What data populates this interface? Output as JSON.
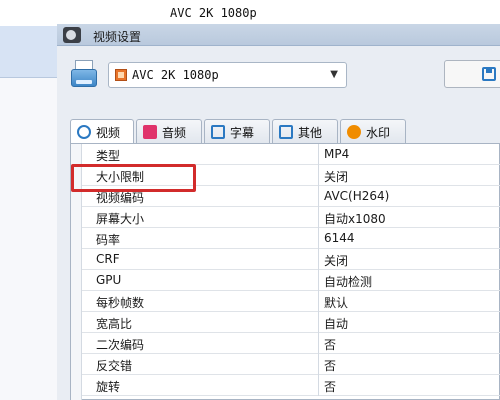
{
  "background": {
    "title": "AVC 2K 1080p"
  },
  "dialog": {
    "title": "视频设置"
  },
  "preset": {
    "selected": "AVC 2K 1080p"
  },
  "tabs": [
    {
      "label": "视频",
      "icon": "video-icon",
      "color": "#2b79c2"
    },
    {
      "label": "音频",
      "icon": "music-icon",
      "color": "#e0336b"
    },
    {
      "label": "字幕",
      "icon": "subtitle-icon",
      "color": "#2b79c2"
    },
    {
      "label": "其他",
      "icon": "settings-icon",
      "color": "#2b79c2"
    },
    {
      "label": "水印",
      "icon": "new-badge-icon",
      "color": "#f08c00"
    }
  ],
  "properties": [
    {
      "key": "类型",
      "value": "MP4"
    },
    {
      "key": "大小限制",
      "value": "关闭"
    },
    {
      "key": "视频编码",
      "value": "AVC(H264)"
    },
    {
      "key": "屏幕大小",
      "value": "自动x1080"
    },
    {
      "key": "码率",
      "value": "6144"
    },
    {
      "key": "CRF",
      "value": "关闭"
    },
    {
      "key": "GPU",
      "value": "自动检测"
    },
    {
      "key": "每秒帧数",
      "value": "默认"
    },
    {
      "key": "宽高比",
      "value": "自动"
    },
    {
      "key": "二次编码",
      "value": "否"
    },
    {
      "key": "反交错",
      "value": "否"
    },
    {
      "key": "旋转",
      "value": "否"
    }
  ],
  "highlight_color": "#d22b2b"
}
